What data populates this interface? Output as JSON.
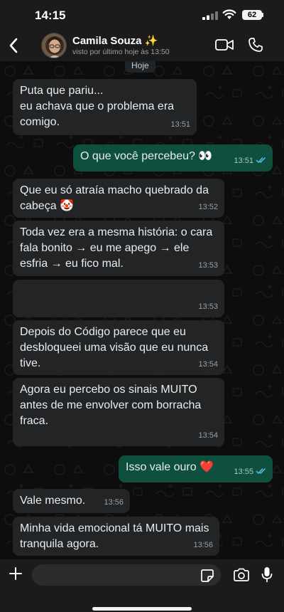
{
  "status_bar": {
    "time": "14:15",
    "battery": "62"
  },
  "header": {
    "contact_name": "Camila Souza ✨",
    "last_seen": "visto por último hoje às 13:50"
  },
  "chat": {
    "day_label": "Hoje",
    "messages": [
      {
        "direction": "in",
        "text": "Puta que pariu...\neu achava que o problema era comigo.",
        "time": "13:51"
      },
      {
        "direction": "out",
        "text": "O que você percebeu? 👀",
        "time": "13:51",
        "status": "read"
      },
      {
        "direction": "in",
        "text": "Que eu só atraía macho quebrado da cabeça 🤡",
        "time": "13:52"
      },
      {
        "direction": "in",
        "text": "Toda vez era a mesma história: o cara fala bonito → eu me apego → ele esfria → eu fico mal.",
        "time": "13:53"
      },
      {
        "direction": "in",
        "text": "",
        "time": "13:53"
      },
      {
        "direction": "in",
        "text": "Depois do Código parece que eu desbloqueei uma visão que eu nunca tive.",
        "time": "13:54"
      },
      {
        "direction": "in",
        "text": "Agora eu percebo os sinais MUITO antes de me envolver com borracha fraca.",
        "time": "13:54"
      },
      {
        "direction": "out",
        "text": "Isso vale ouro ❤️",
        "time": "13:55",
        "status": "read"
      },
      {
        "direction": "in",
        "text": "Vale mesmo.",
        "time": "13:56"
      },
      {
        "direction": "in",
        "text": "Minha vida emocional tá MUITO mais tranquila agora.",
        "time": "13:56"
      }
    ]
  },
  "composer": {
    "value": "",
    "placeholder": ""
  },
  "colors": {
    "incoming": "#222426",
    "outgoing": "#0e4f3e",
    "read_ticks": "#53bdeb"
  },
  "icons": [
    "back-icon",
    "video-call-icon",
    "phone-icon",
    "plus-icon",
    "sticker-icon",
    "camera-icon",
    "microphone-icon"
  ]
}
